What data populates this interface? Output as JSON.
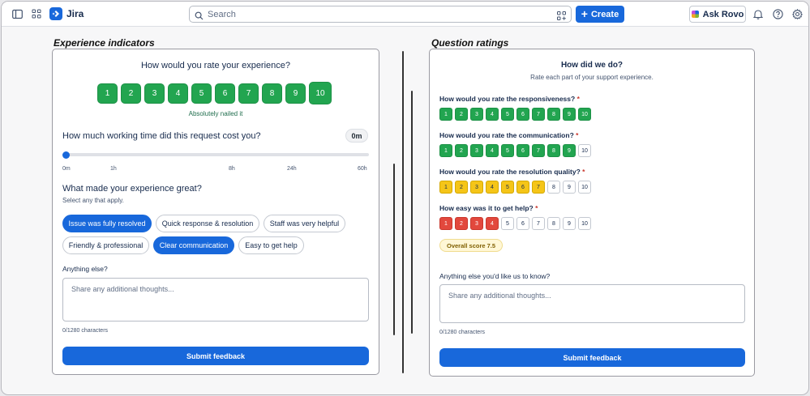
{
  "topbar": {
    "app_name": "Jira",
    "search_placeholder": "Search",
    "create_label": "Create",
    "ask_rovo_label": "Ask Rovo",
    "colors": {
      "brand": "#1868db"
    }
  },
  "left": {
    "section_title": "Experience indicators",
    "rating_question": "How would you rate your experience?",
    "ratings": [
      "1",
      "2",
      "3",
      "4",
      "5",
      "6",
      "7",
      "8",
      "9",
      "10"
    ],
    "selected_rating": 10,
    "rating_caption": "Absolutely nailed it",
    "time_question": "How much working time did this request cost you?",
    "time_value": "0m",
    "slider_value_fraction": 0,
    "time_ticks": [
      "0m",
      "1h",
      "8h",
      "24h",
      "60h"
    ],
    "great_question": "What made your experience great?",
    "great_hint": "Select any that apply.",
    "chips": [
      {
        "label": "Issue was fully resolved",
        "selected": true
      },
      {
        "label": "Quick response & resolution",
        "selected": false
      },
      {
        "label": "Staff was very helpful",
        "selected": false
      },
      {
        "label": "Friendly & professional",
        "selected": false
      },
      {
        "label": "Clear communication",
        "selected": true
      },
      {
        "label": "Easy to get help",
        "selected": false
      }
    ],
    "anything_label": "Anything else?",
    "anything_placeholder": "Share any additional thoughts...",
    "char_count": "0/1280 characters",
    "submit_label": "Submit feedback"
  },
  "right": {
    "section_title": "Question ratings",
    "title": "How did we do?",
    "subtitle": "Rate each part of your support experience.",
    "questions": [
      {
        "label": "How would you rate the responsiveness?",
        "required": "*",
        "selected": 10,
        "color": "green"
      },
      {
        "label": "How would you rate the communication?",
        "required": "*",
        "selected": 9,
        "color": "green"
      },
      {
        "label": "How would you rate the resolution quality?",
        "required": "*",
        "selected": 7,
        "color": "yellow"
      },
      {
        "label": "How easy was it to get help?",
        "required": "*",
        "selected": 4,
        "color": "red"
      }
    ],
    "scale": [
      "1",
      "2",
      "3",
      "4",
      "5",
      "6",
      "7",
      "8",
      "9",
      "10"
    ],
    "overall_score": "Overall score 7.5",
    "anything_label": "Anything else you'd like us to know?",
    "anything_placeholder": "Share any additional thoughts...",
    "char_count": "0/1280 characters",
    "submit_label": "Submit feedback"
  }
}
